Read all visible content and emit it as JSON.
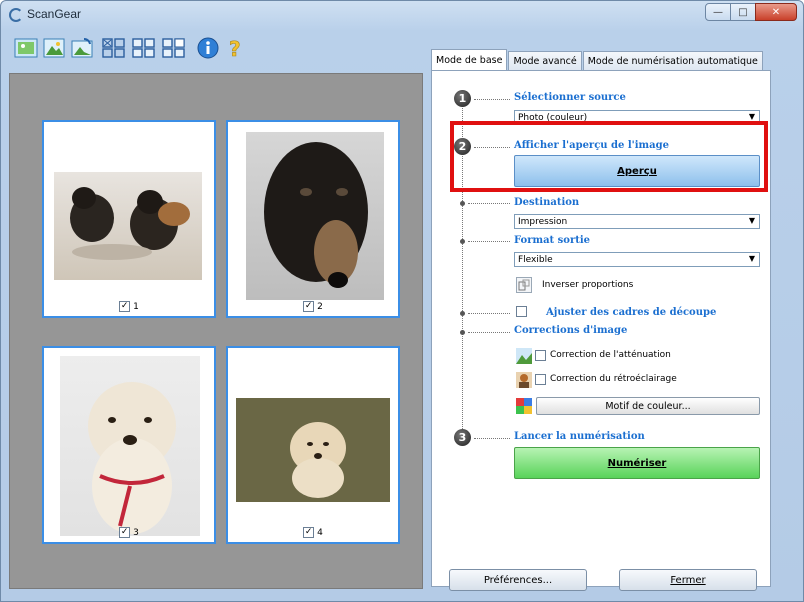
{
  "window": {
    "title": "ScanGear"
  },
  "tabs": [
    {
      "label": "Mode de base"
    },
    {
      "label": "Mode avancé"
    },
    {
      "label": "Mode de numérisation automatique"
    }
  ],
  "thumbnails": [
    {
      "index": "1",
      "checked": true
    },
    {
      "index": "2",
      "checked": true
    },
    {
      "index": "3",
      "checked": true
    },
    {
      "index": "4",
      "checked": true
    }
  ],
  "steps": {
    "step1_number": "1",
    "step1_title": "Sélectionner source",
    "source_value": "Photo (couleur)",
    "step2_number": "2",
    "step2_title": "Afficher l'aperçu de l'image",
    "preview_button": "Aperçu",
    "destination_label": "Destination",
    "destination_value": "Impression",
    "output_format_label": "Format sortie",
    "output_format_value": "Flexible",
    "invert_proportions": "Inverser proportions",
    "adjust_crop_frames": "Ajuster des cadres de découpe",
    "image_corrections_label": "Corrections d'image",
    "fade_correction": "Correction de l'atténuation",
    "backlight_correction": "Correction du rétroéclairage",
    "color_pattern_button": "Motif de couleur...",
    "step3_number": "3",
    "step3_title": "Lancer la numérisation",
    "scan_button": "Numériser"
  },
  "bottom": {
    "preferences_button": "Préférences...",
    "close_button": "Fermer"
  },
  "colors": {
    "accent_blue": "#1b6fd0",
    "highlight_red": "#e01010",
    "scan_green": "#59d35a",
    "preview_blue": "#8ec0ec",
    "preview_bg": "#969696"
  }
}
